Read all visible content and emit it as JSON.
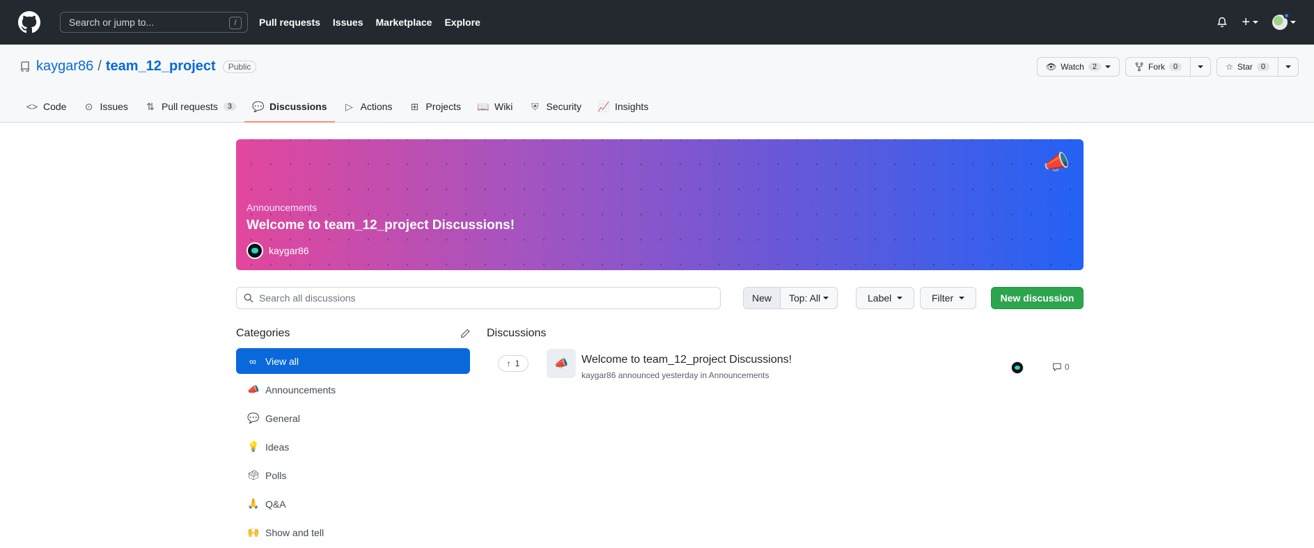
{
  "header": {
    "search_placeholder": "Search or jump to...",
    "search_shortcut": "/",
    "nav": [
      "Pull requests",
      "Issues",
      "Marketplace",
      "Explore"
    ]
  },
  "repo": {
    "owner": "kaygar86",
    "separator": "/",
    "name": "team_12_project",
    "visibility": "Public",
    "watch_label": "Watch",
    "watch_count": "2",
    "fork_label": "Fork",
    "fork_count": "0",
    "star_label": "Star",
    "star_count": "0"
  },
  "tabs": [
    {
      "label": "Code",
      "icon": "code-icon"
    },
    {
      "label": "Issues",
      "icon": "issue-icon"
    },
    {
      "label": "Pull requests",
      "icon": "pull-request-icon",
      "count": "3"
    },
    {
      "label": "Discussions",
      "icon": "discussions-icon",
      "active": true
    },
    {
      "label": "Actions",
      "icon": "play-icon"
    },
    {
      "label": "Projects",
      "icon": "table-icon"
    },
    {
      "label": "Wiki",
      "icon": "book-icon"
    },
    {
      "label": "Security",
      "icon": "shield-icon"
    },
    {
      "label": "Insights",
      "icon": "graph-icon"
    }
  ],
  "banner": {
    "category": "Announcements",
    "title": "Welcome to team_12_project Discussions!",
    "author": "kaygar86"
  },
  "toolbar": {
    "search_placeholder": "Search all discussions",
    "sort_new": "New",
    "sort_top": "Top: All",
    "label_btn": "Label",
    "filter_btn": "Filter",
    "new_discussion": "New discussion"
  },
  "categories": {
    "heading": "Categories",
    "items": [
      {
        "label": "View all",
        "icon": "infinity-icon",
        "glyph": "∞",
        "active": true
      },
      {
        "label": "Announcements",
        "icon": "megaphone-icon",
        "glyph": "📣"
      },
      {
        "label": "General",
        "icon": "speech-bubble-icon",
        "glyph": "💬"
      },
      {
        "label": "Ideas",
        "icon": "lightbulb-icon",
        "glyph": "💡"
      },
      {
        "label": "Polls",
        "icon": "ballot-box-icon",
        "glyph": "🗳"
      },
      {
        "label": "Q&A",
        "icon": "folded-hands-icon",
        "glyph": "🙏"
      },
      {
        "label": "Show and tell",
        "icon": "raising-hands-icon",
        "glyph": "🙌"
      }
    ]
  },
  "discussions": {
    "heading": "Discussions",
    "items": [
      {
        "votes": "1",
        "title": "Welcome to team_12_project Discussions!",
        "meta": "kaygar86 announced yesterday in Announcements",
        "comments": "0"
      }
    ]
  },
  "colors": {
    "header_bg": "#24292f",
    "accent_blue": "#0969da",
    "green_button": "#2da44e",
    "active_tab_underline": "#fd8c73"
  }
}
